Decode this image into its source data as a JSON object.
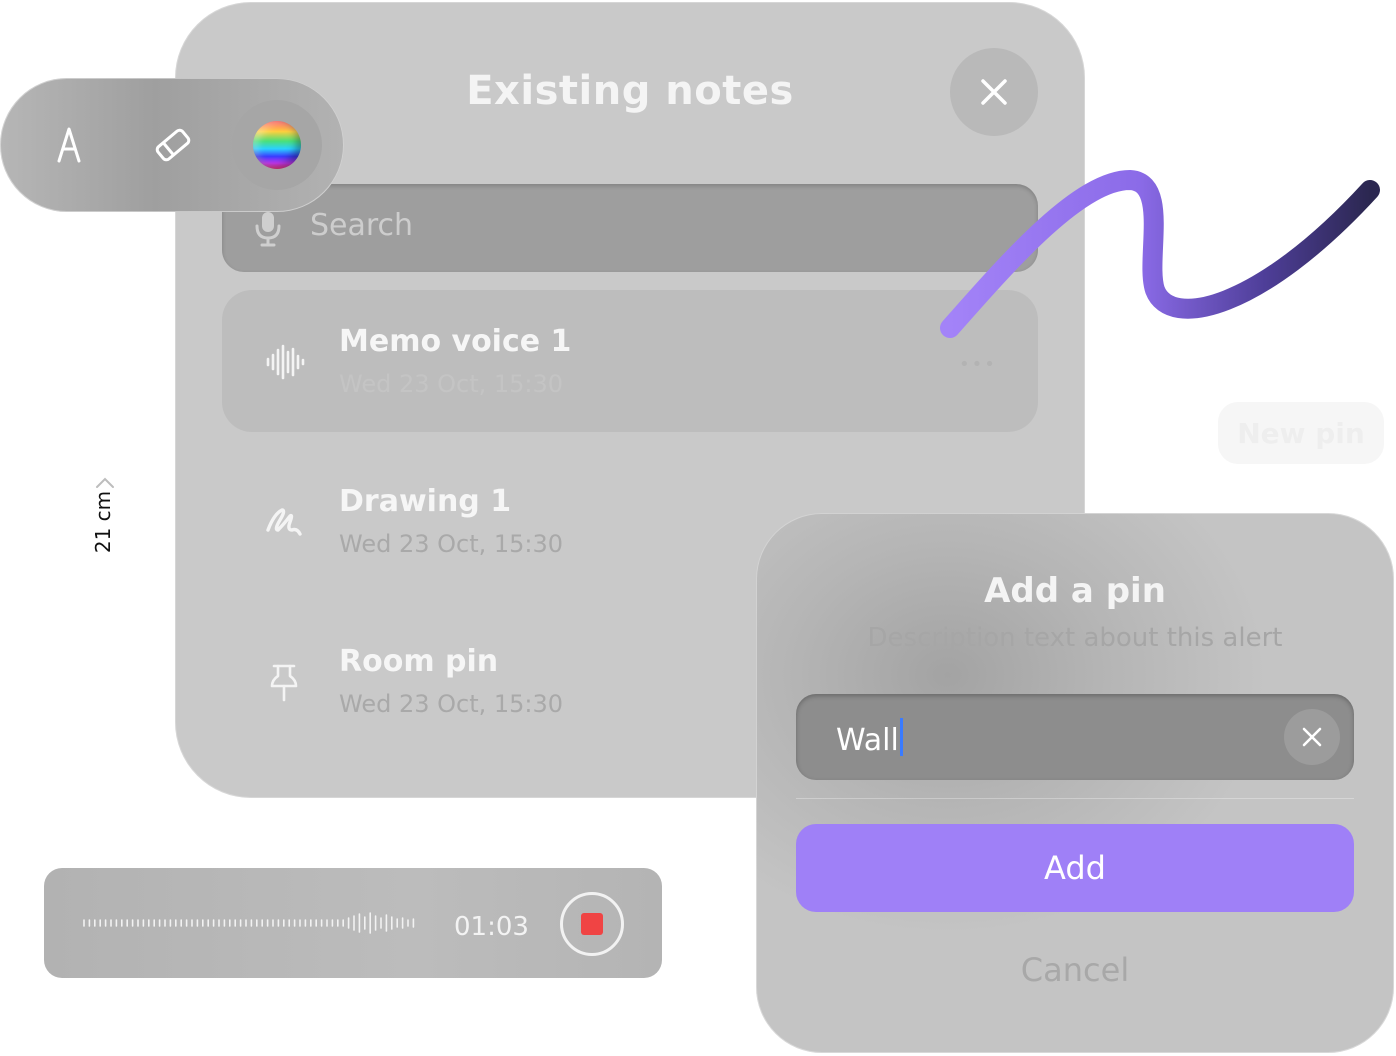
{
  "notes_panel": {
    "title": "Existing notes",
    "search_placeholder": "Search",
    "items": [
      {
        "title": "Memo voice 1",
        "date": "Wed 23 Oct, 15:30",
        "icon": "waveform-icon",
        "selected": true
      },
      {
        "title": "Drawing 1",
        "date": "Wed 23 Oct, 15:30",
        "icon": "scribble-icon",
        "selected": false
      },
      {
        "title": "Room pin",
        "date": "Wed 23 Oct, 15:30",
        "icon": "pin-icon",
        "selected": false
      }
    ],
    "more_label": "•••"
  },
  "tool_pill": {
    "tools": [
      "pen-icon",
      "eraser-icon",
      "color-picker-icon"
    ]
  },
  "new_pin": {
    "label": "New pin"
  },
  "ruler": {
    "label": "21 cm"
  },
  "recording": {
    "time": "01:03"
  },
  "add_pin_dialog": {
    "title": "Add a pin",
    "description": "Description text about this alert",
    "input_value": "Wall",
    "add_label": "Add",
    "cancel_label": "Cancel"
  },
  "colors": {
    "accent": "#9f80f7",
    "stroke_start": "#a383f8",
    "stroke_end": "#2b2750",
    "record": "#f04444",
    "caret": "#3a7bff"
  }
}
